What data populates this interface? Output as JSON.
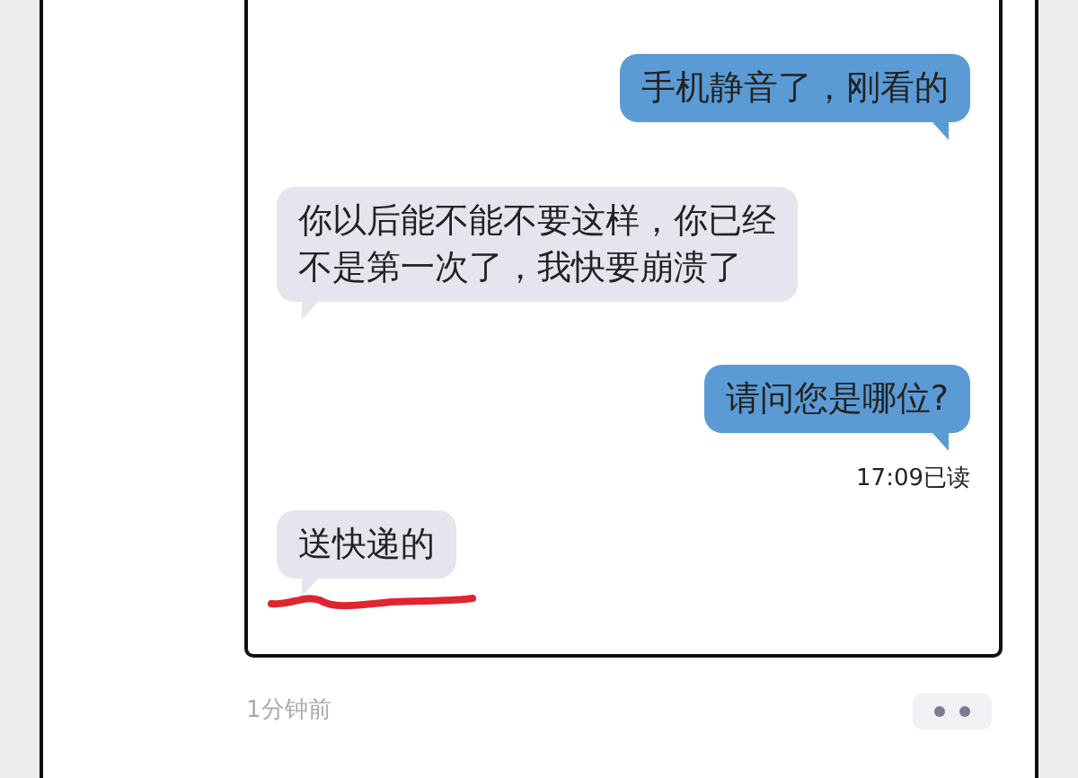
{
  "messages": [
    {
      "kind": "sent",
      "lines": [
        "手机静音了，刚看的"
      ]
    },
    {
      "kind": "received",
      "lines": [
        "你以后能不能不要这样，你已经",
        "不是第一次了，我快要崩溃了"
      ]
    },
    {
      "kind": "sent",
      "lines": [
        "请问您是哪位?"
      ],
      "status": "17:09已读"
    },
    {
      "kind": "received",
      "lines": [
        "送快递的"
      ],
      "underlined": true
    }
  ],
  "post": {
    "time": "1分钟前"
  }
}
